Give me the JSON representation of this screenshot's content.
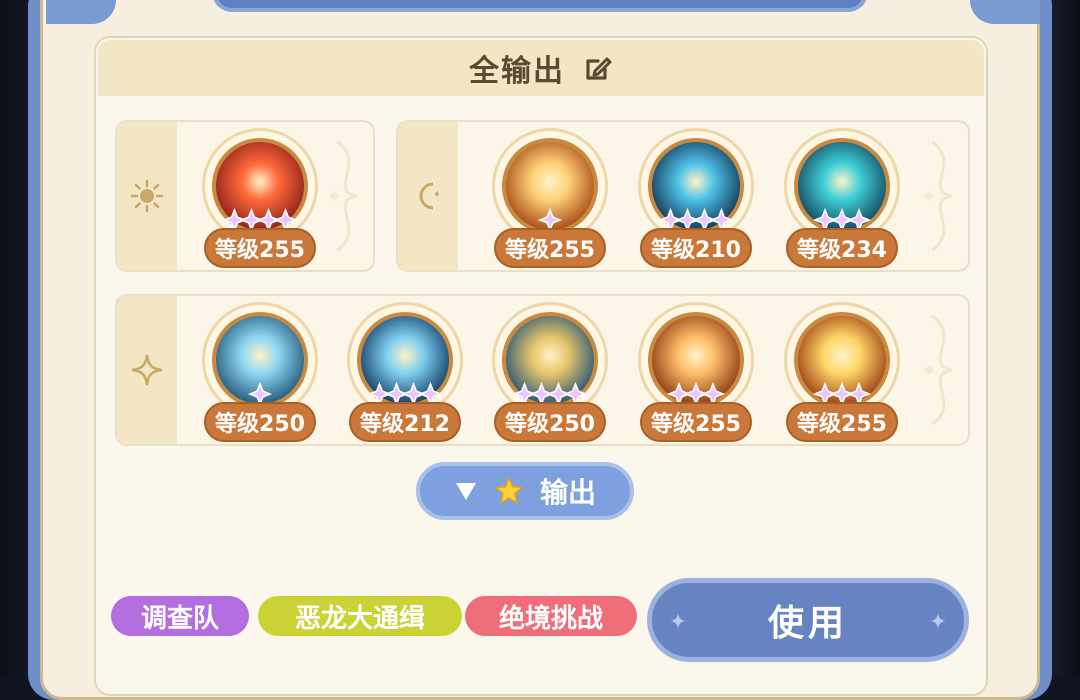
{
  "team": {
    "title": "全输出",
    "edit_icon": "edit-icon"
  },
  "rows": [
    {
      "id": "sun",
      "icon": "sun-icon",
      "characters": [
        {
          "art": "crimson-sword-burst",
          "level": "等级255",
          "stars": 4,
          "colors": [
            "#ff6a3a",
            "#8a1d17"
          ]
        }
      ]
    },
    {
      "id": "moon",
      "icon": "moon-icon",
      "characters": [
        {
          "art": "golden-flare-burst",
          "level": "等级255",
          "stars": 1,
          "colors": [
            "#ffd27a",
            "#a34612"
          ]
        },
        {
          "art": "blue-flame-silhouette",
          "level": "等级210",
          "stars": 4,
          "colors": [
            "#4ec1e8",
            "#10324f"
          ]
        },
        {
          "art": "teal-guardian",
          "level": "等级234",
          "stars": 3,
          "colors": [
            "#3fd0d8",
            "#134258"
          ]
        }
      ]
    },
    {
      "id": "sparkle",
      "icon": "sparkle-icon",
      "characters": [
        {
          "art": "lightning-blade",
          "level": "等级250",
          "stars": 1,
          "colors": [
            "#8fd7f2",
            "#1e5577"
          ]
        },
        {
          "art": "galaxy-ring",
          "level": "等级212",
          "stars": 4,
          "colors": [
            "#7fd0f0",
            "#0f3560"
          ]
        },
        {
          "art": "wave-swirl",
          "level": "等级250",
          "stars": 4,
          "colors": [
            "#e8c56a",
            "#1c5278"
          ]
        },
        {
          "art": "golden-arrows",
          "level": "等级255",
          "stars": 3,
          "colors": [
            "#ffbe6a",
            "#8a3410"
          ]
        },
        {
          "art": "sun-eruption",
          "level": "等级255",
          "stars": 3,
          "colors": [
            "#ffd86a",
            "#9a3a10"
          ]
        }
      ]
    }
  ],
  "filter": {
    "arrow_icon": "triangle-down-icon",
    "star_icon": "star-icon",
    "label": "输出"
  },
  "tags": [
    {
      "label": "调查队",
      "color": "#b36ee0"
    },
    {
      "label": "恶龙大通缉",
      "color": "#cbd235"
    },
    {
      "label": "绝境挑战",
      "color": "#f06e7a"
    }
  ],
  "use_button": {
    "label": "使用"
  }
}
